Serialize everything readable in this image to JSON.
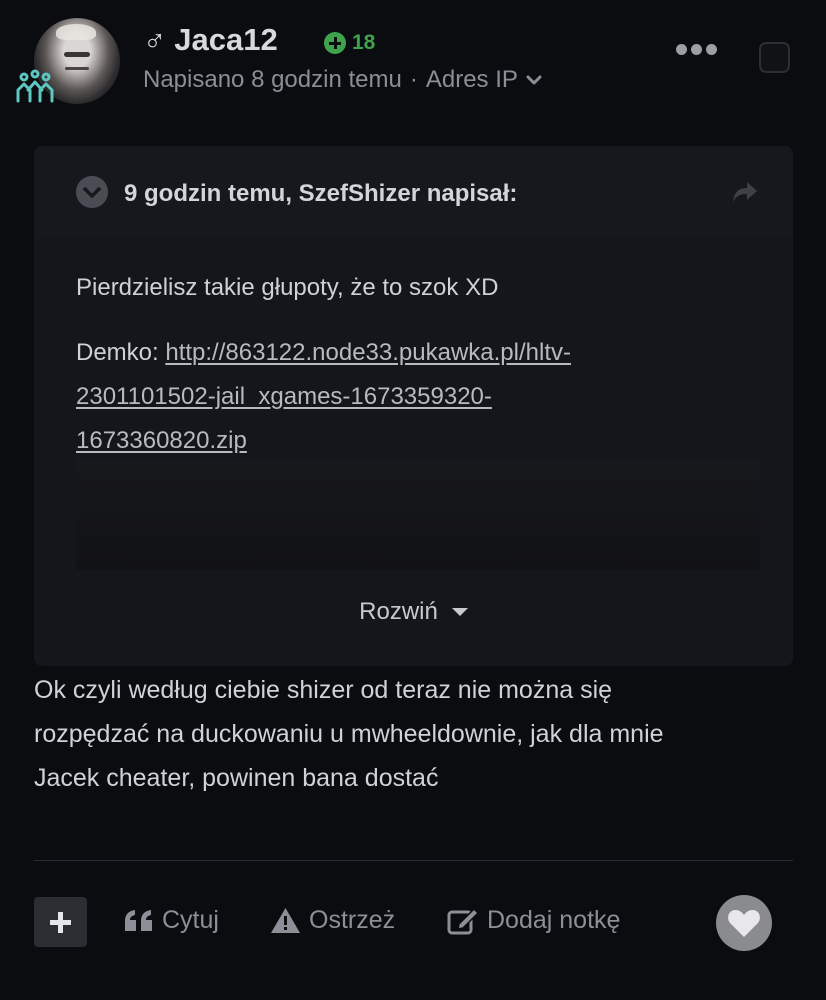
{
  "author": {
    "gender_symbol": "♂",
    "username": "Jaca12",
    "reputation": "18",
    "meta_posted": "Napisano 8 godzin temu",
    "meta_separator": "·",
    "meta_ip": "Adres IP"
  },
  "quote": {
    "header": "9 godzin temu, SzefShizer napisał:",
    "text": "Pierdzielisz takie głupoty, że to szok XD",
    "demo_label": "Demko: ",
    "demo_link_line1": "http://863122.node33.pukawka.pl/hltv-",
    "demo_link_line2": "2301101502-jail_xgames-1673359320-",
    "demo_link_line3": "1673360820.zip",
    "expand_label": "Rozwiń"
  },
  "post": {
    "line1": "Ok czyli według ciebie shizer od teraz nie można się",
    "line2": "rozpędzać na duckowaniu u mwheeldownie, jak dla mnie",
    "line3": "Jacek cheater, powinen bana dostać"
  },
  "actions": {
    "quote_label": "Cytuj",
    "warn_label": "Ostrzeż",
    "note_label": "Dodaj notkę"
  },
  "icons": {
    "badge": "group-badge-icon",
    "plus": "plus-icon",
    "quote": "quote-icon",
    "warn": "warning-icon",
    "note": "edit-note-icon",
    "heart": "heart-icon",
    "more": "ellipsis-icon",
    "share": "share-icon",
    "toggle": "chevron-down-icon"
  },
  "colors": {
    "background": "#0b0c10",
    "reputation": "#3fa34d",
    "badge": "#5fc7c1"
  }
}
